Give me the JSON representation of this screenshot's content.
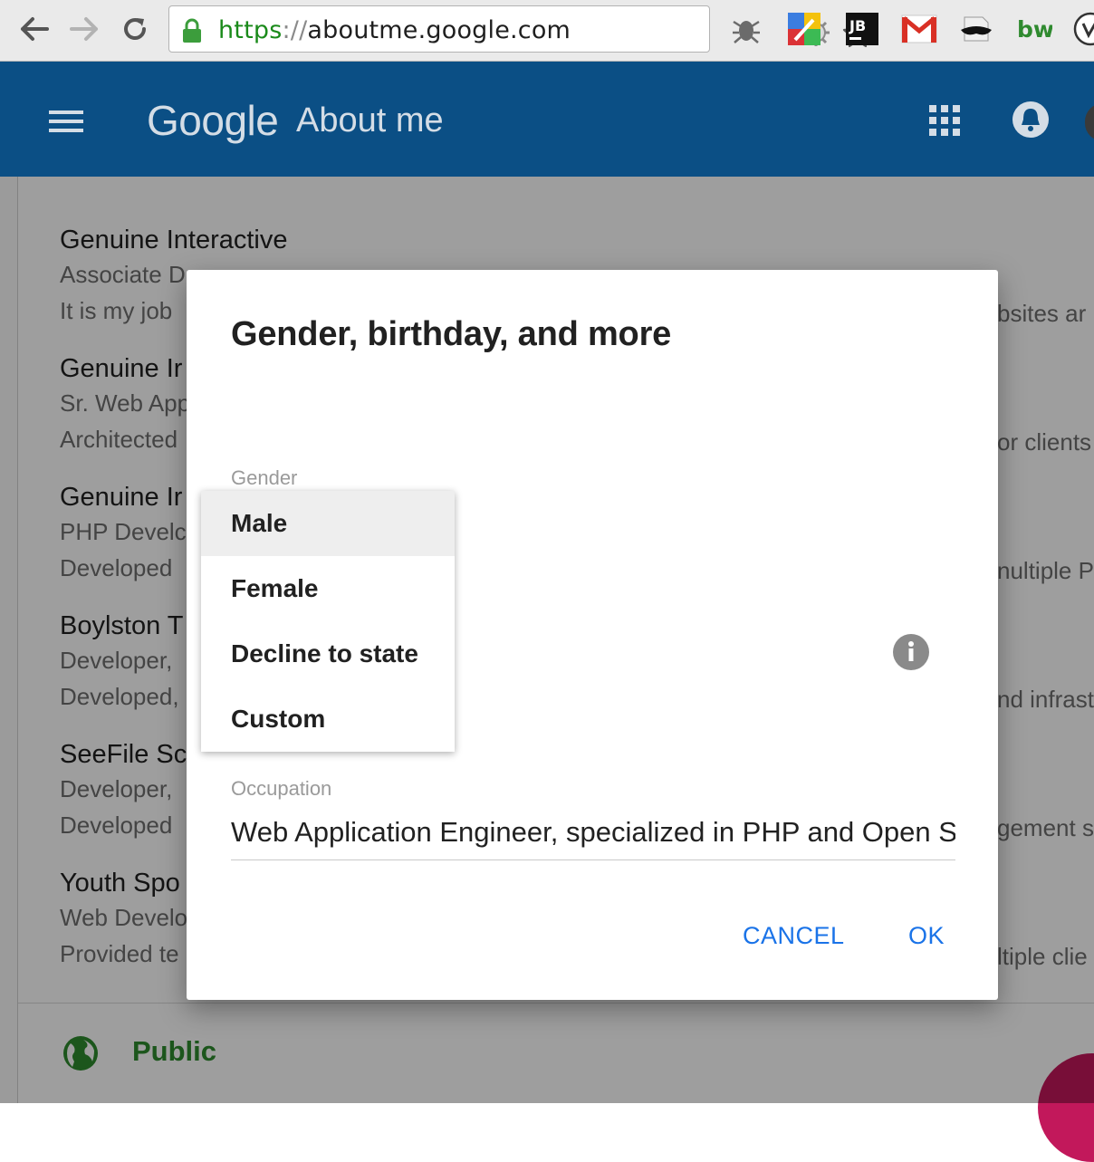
{
  "browser": {
    "url_scheme": "https",
    "url_separator": "://",
    "url_host": "aboutme.google.com",
    "extensions": [
      "bug-icon",
      "color-picker-icon",
      "jetbrains-icon",
      "gmail-icon",
      "disguise-icon",
      "bw-icon",
      "vimeo-icon"
    ],
    "ext_jb_label": "JB",
    "ext_bw_label": "bw"
  },
  "header": {
    "brand": "Google",
    "product": "About me",
    "color": "#0b4f85"
  },
  "background_jobs": [
    {
      "company": "Genuine Interactive",
      "role": "Associate D",
      "desc": "It is my job",
      "right": "bsites ar"
    },
    {
      "company": "Genuine Ir",
      "role": "Sr. Web App",
      "desc": "Architected",
      "right": "or clients"
    },
    {
      "company": "Genuine Ir",
      "role": "PHP Develc",
      "desc": "Developed",
      "right": "nultiple P"
    },
    {
      "company": "Boylston T",
      "role": "Developer, ",
      "desc": "Developed,",
      "right": "nd infrast"
    },
    {
      "company": "SeeFile Sc",
      "role": "Developer, ",
      "desc": "Developed",
      "right": "gement s"
    },
    {
      "company": "Youth Spo",
      "role": "Web Develo",
      "desc": "Provided te",
      "right": "ltiple clie"
    }
  ],
  "footer": {
    "visibility": "Public"
  },
  "dialog": {
    "title": "Gender, birthday, and more",
    "gender_label": "Gender",
    "gender_options": [
      "Male",
      "Female",
      "Decline to state",
      "Custom"
    ],
    "gender_selected": "Male",
    "occupation_label": "Occupation",
    "occupation_value": "Web Application Engineer, specialized in PHP and Open Source",
    "cancel_label": "CANCEL",
    "ok_label": "OK"
  },
  "colors": {
    "accent": "#1a73e8",
    "public_green": "#2e8b2e"
  }
}
